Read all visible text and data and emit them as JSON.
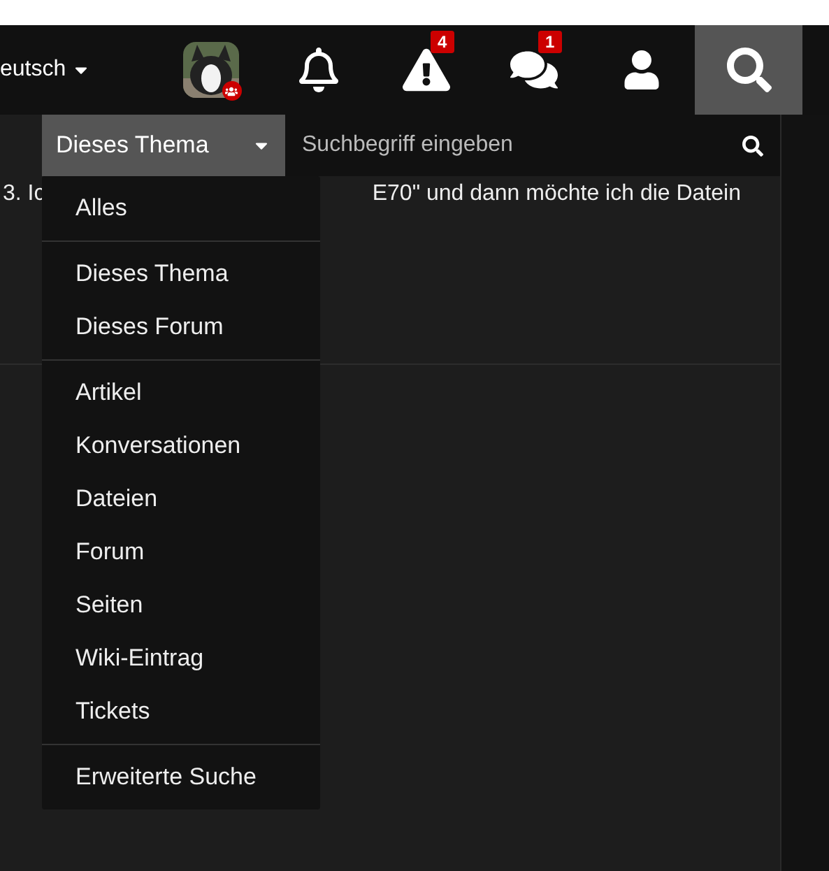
{
  "header": {
    "language": "eutsch",
    "alerts_badge": "4",
    "messages_badge": "1",
    "search_active": true
  },
  "search": {
    "scope": "Dieses Thema",
    "placeholder": "Suchbegriff eingeben"
  },
  "content": {
    "text_left": "3. Ic",
    "text_right": "E70\" und dann möchte ich die Datein"
  },
  "scope_menu": [
    {
      "items": [
        "Alles"
      ]
    },
    {
      "items": [
        "Dieses Thema",
        "Dieses Forum"
      ]
    },
    {
      "items": [
        "Artikel",
        "Konversationen",
        "Dateien",
        "Forum",
        "Seiten",
        "Wiki-Eintrag",
        "Tickets"
      ]
    },
    {
      "items": [
        "Erweiterte Suche"
      ]
    }
  ]
}
